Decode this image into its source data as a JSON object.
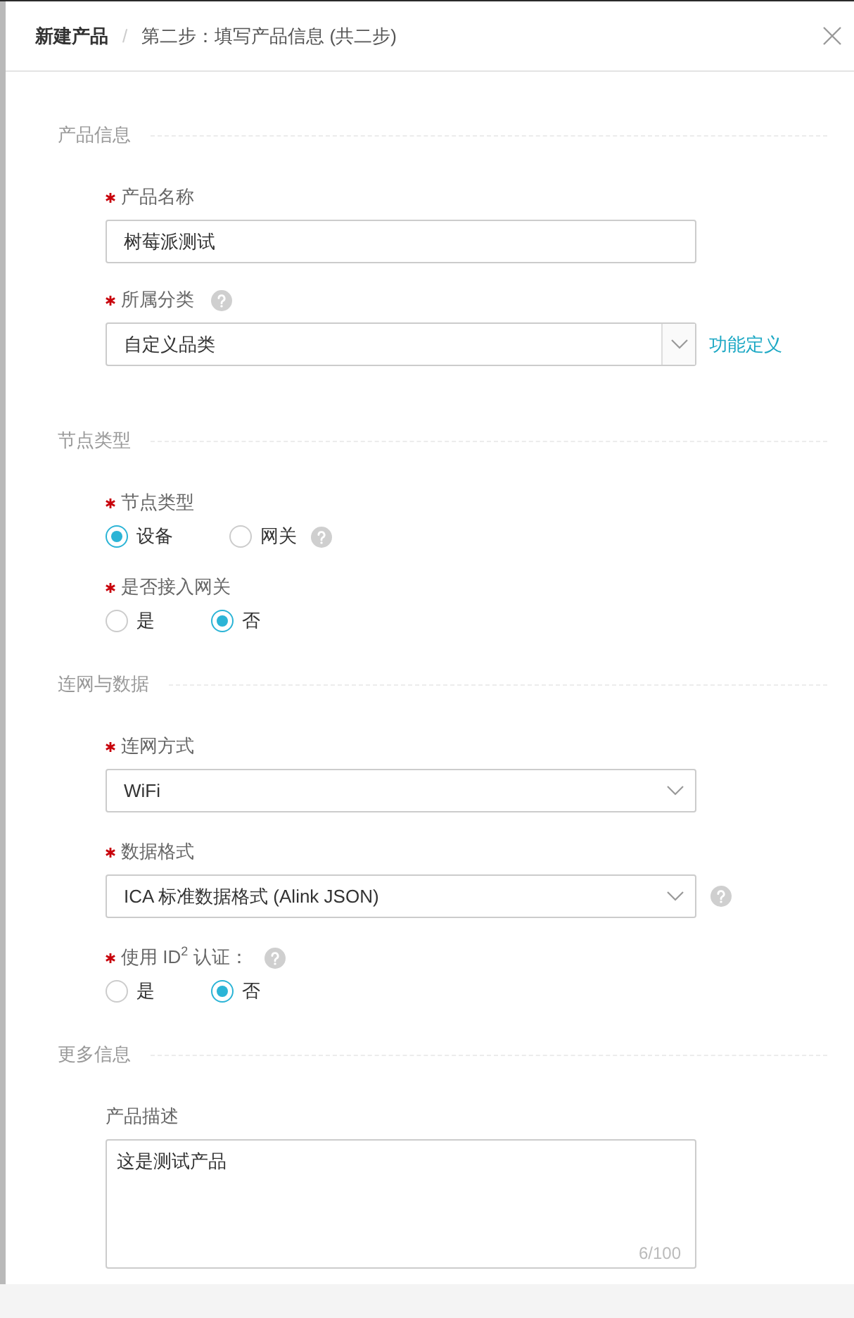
{
  "breadcrumb": {
    "items": [
      "新建产品",
      "第二步：填写产品信息 (共二步)"
    ],
    "separator": "/"
  },
  "sections": [
    {
      "title": "产品信息",
      "fields": [
        {
          "kind": "input",
          "label": "产品名称",
          "required": true,
          "value": "树莓派测试"
        },
        {
          "kind": "combo",
          "label": "所属分类",
          "required": true,
          "label_help": true,
          "value": "自定义品类",
          "link": "功能定义"
        }
      ]
    },
    {
      "title": "节点类型",
      "fields": [
        {
          "kind": "radio",
          "label": "节点类型",
          "required": true,
          "control_help": true,
          "options": [
            {
              "label": "设备",
              "selected": true
            },
            {
              "label": "网关",
              "selected": false
            }
          ]
        },
        {
          "kind": "radio",
          "label": "是否接入网关",
          "required": true,
          "options": [
            {
              "label": "是",
              "selected": false
            },
            {
              "label": "否",
              "selected": true
            }
          ]
        }
      ]
    },
    {
      "title": "连网与数据",
      "fields": [
        {
          "kind": "select",
          "label": "连网方式",
          "required": true,
          "value": "WiFi"
        },
        {
          "kind": "select",
          "label": "数据格式",
          "required": true,
          "control_help": true,
          "value": "ICA 标准数据格式 (Alink JSON)"
        },
        {
          "kind": "radio",
          "label": "使用 ID$^{2}$ 认证：",
          "required": true,
          "label_help": true,
          "options": [
            {
              "label": "是",
              "selected": false
            },
            {
              "label": "否",
              "selected": true
            }
          ]
        }
      ]
    },
    {
      "title": "更多信息",
      "fields": [
        {
          "kind": "textarea",
          "label": "产品描述",
          "value": "这是测试产品",
          "counter": "6/100"
        }
      ]
    }
  ]
}
